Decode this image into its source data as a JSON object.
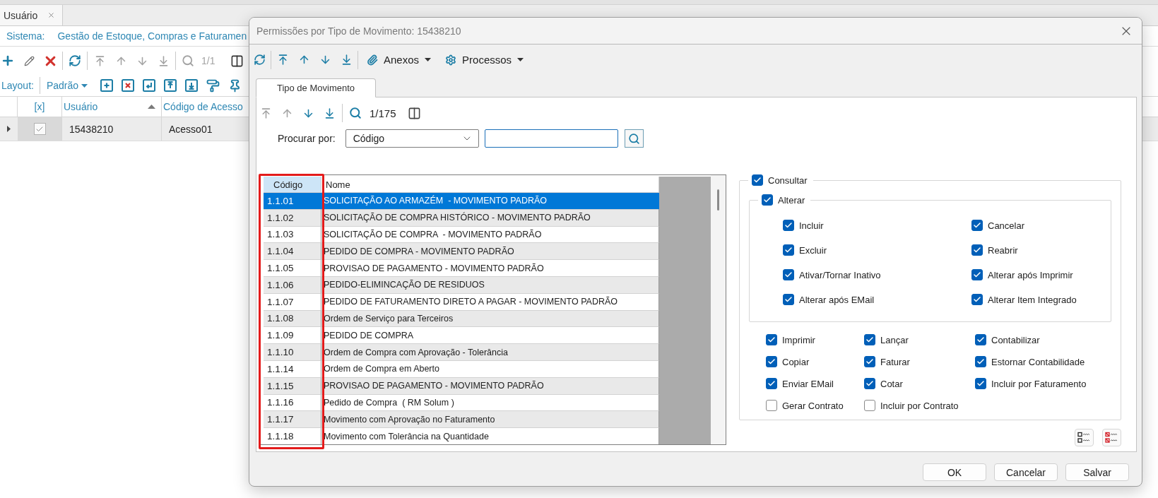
{
  "background": {
    "tabs": [
      {
        "label": "Usuário",
        "selected": true
      }
    ],
    "system": {
      "label": "Sistema:",
      "value": "Gestão de Estoque, Compras e Faturamen"
    },
    "toolbar": {
      "nav_buttons": [
        {
          "disabled": true
        },
        {
          "disabled": true
        },
        {
          "disabled": true
        },
        {
          "disabled": true
        }
      ],
      "counter": "1/1"
    },
    "layout_bar": {
      "label": "Layout:",
      "value": "Padrão"
    },
    "grid": {
      "check_column": {
        "label": "[x]"
      },
      "columns": [
        {
          "label": "Usuário",
          "sorted": true
        },
        {
          "label": "Código de Acesso",
          "sorted": false
        }
      ],
      "rows": [
        {
          "checked": true,
          "cells": [
            "15438210",
            "Acesso01"
          ]
        }
      ]
    }
  },
  "dialog": {
    "title": "Permissões por Tipo de Movimento: 15438210",
    "toolbar": {
      "nav_buttons": [
        {
          "disabled": false
        },
        {
          "disabled": false
        },
        {
          "disabled": false
        },
        {
          "disabled": false
        }
      ],
      "menus": [
        {
          "label": "Anexos"
        },
        {
          "label": "Processos"
        }
      ]
    },
    "tabs": [
      {
        "label": "Tipo de Movimento",
        "selected": true
      }
    ],
    "navigator": {
      "nav_buttons": [
        {
          "disabled": true
        },
        {
          "disabled": true
        },
        {
          "disabled": false
        },
        {
          "disabled": false
        }
      ],
      "counter": "1/175"
    },
    "search": {
      "label": "Procurar por:",
      "field": "Código"
    },
    "table": {
      "columns": [
        {
          "label": "Código",
          "selected": true,
          "outlined": true
        },
        {
          "label": "Nome",
          "selected": false,
          "outlined": false
        }
      ],
      "rows": [
        {
          "code": "1.1.01",
          "name": "SOLICITAÇÃO AO ARMAZÉM  - MOVIMENTO PADRÃO",
          "selected": true
        },
        {
          "code": "1.1.02",
          "name": "SOLICITAÇÃO DE COMPRA HISTÓRICO - MOVIMENTO PADRÃO",
          "selected": false
        },
        {
          "code": "1.1.03",
          "name": "SOLICITAÇÃO DE COMPRA  - MOVIMENTO PADRÃO",
          "selected": false
        },
        {
          "code": "1.1.04",
          "name": "PEDIDO DE COMPRA - MOVIMENTO PADRÃO",
          "selected": false
        },
        {
          "code": "1.1.05",
          "name": "PROVISAO DE PAGAMENTO - MOVIMENTO PADRÃO",
          "selected": false
        },
        {
          "code": "1.1.06",
          "name": "PEDIDO-ELIMINCAÇÃO DE RESIDUOS",
          "selected": false
        },
        {
          "code": "1.1.07",
          "name": "PEDIDO DE FATURAMENTO DIRETO A PAGAR - MOVIMENTO PADRÃO",
          "selected": false
        },
        {
          "code": "1.1.08",
          "name": "Ordem de Serviço para Terceiros",
          "selected": false
        },
        {
          "code": "1.1.09",
          "name": "PEDIDO DE COMPRA",
          "selected": false
        },
        {
          "code": "1.1.10",
          "name": "Ordem de Compra com Aprovação - Tolerância",
          "selected": false
        },
        {
          "code": "1.1.14",
          "name": "Ordem de Compra em Aberto",
          "selected": false
        },
        {
          "code": "1.1.15",
          "name": "PROVISAO DE PAGAMENTO - MOVIMENTO PADRÃO",
          "selected": false
        },
        {
          "code": "1.1.16",
          "name": "Pedido de Compra  ( RM Solum )",
          "selected": false
        },
        {
          "code": "1.1.17",
          "name": "Movimento com Aprovação no Faturamento",
          "selected": false
        },
        {
          "code": "1.1.18",
          "name": "Movimento com Tolerância na Quantidade",
          "selected": false
        }
      ]
    },
    "permissions": {
      "consult": {
        "label": "Consultar",
        "checked": true
      },
      "change": {
        "label": "Alterar",
        "checked": true
      },
      "change_options": [
        {
          "label": "Incluir",
          "checked": true
        },
        {
          "label": "Cancelar",
          "checked": true
        },
        {
          "label": "Excluir",
          "checked": true
        },
        {
          "label": "Reabrir",
          "checked": true
        },
        {
          "label": "Ativar/Tornar Inativo",
          "checked": true
        },
        {
          "label": "Alterar após Imprimir",
          "checked": true
        },
        {
          "label": "Alterar após EMail",
          "checked": true
        },
        {
          "label": "Alterar Item Integrado",
          "checked": true
        }
      ],
      "other_options": [
        {
          "label": "Imprimir",
          "checked": true
        },
        {
          "label": "Lançar",
          "checked": true
        },
        {
          "label": "Contabilizar",
          "checked": true
        },
        {
          "label": "Copiar",
          "checked": true
        },
        {
          "label": "Faturar",
          "checked": true
        },
        {
          "label": "Estornar Contabilidade",
          "checked": true
        },
        {
          "label": "Enviar EMail",
          "checked": true
        },
        {
          "label": "Cotar",
          "checked": true
        },
        {
          "label": "Incluir por Faturamento",
          "checked": true
        },
        {
          "label": "Gerar Contrato",
          "checked": false
        },
        {
          "label": "Incluir por Contrato",
          "checked": false
        }
      ]
    },
    "buttons": [
      {
        "label": "OK"
      },
      {
        "label": "Cancelar"
      },
      {
        "label": "Salvar"
      }
    ]
  }
}
